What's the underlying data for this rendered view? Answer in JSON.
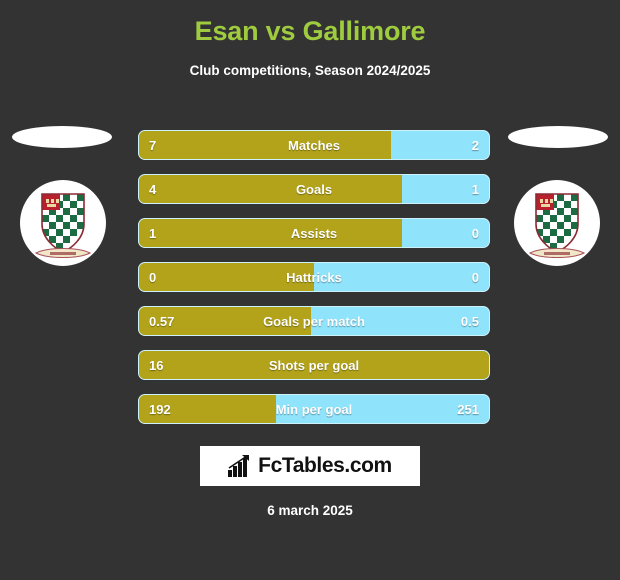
{
  "header": {
    "title": "Esan vs Gallimore",
    "subtitle": "Club competitions, Season 2024/2025"
  },
  "colors": {
    "background": "#333333",
    "title": "#9fcb3f",
    "home_bar": "#b3a31b",
    "away_bar": "#8fe3fb",
    "text": "#ffffff"
  },
  "crests": {
    "left_name": "club-crest-left",
    "right_name": "club-crest-right"
  },
  "chart_data": {
    "type": "bar",
    "title": "Esan vs Gallimore",
    "subtitle": "Club competitions, Season 2024/2025",
    "orientation": "horizontal-diverging",
    "series": [
      {
        "name": "Esan",
        "color": "#b3a31b"
      },
      {
        "name": "Gallimore",
        "color": "#8fe3fb"
      }
    ],
    "categories": [
      "Matches",
      "Goals",
      "Assists",
      "Hattricks",
      "Goals per match",
      "Shots per goal",
      "Min per goal"
    ],
    "rows": [
      {
        "label": "Matches",
        "home": "7",
        "away": "2",
        "home_pct": 72
      },
      {
        "label": "Goals",
        "home": "4",
        "away": "1",
        "home_pct": 75
      },
      {
        "label": "Assists",
        "home": "1",
        "away": "0",
        "home_pct": 75
      },
      {
        "label": "Hattricks",
        "home": "0",
        "away": "0",
        "home_pct": 50
      },
      {
        "label": "Goals per match",
        "home": "0.57",
        "away": "0.5",
        "home_pct": 49
      },
      {
        "label": "Shots per goal",
        "home": "16",
        "away": "",
        "home_pct": 100
      },
      {
        "label": "Min per goal",
        "home": "192",
        "away": "251",
        "home_pct": 39
      }
    ]
  },
  "footer": {
    "logo_text": "FcTables.com",
    "logo_icon": "bar-chart-icon",
    "date": "6 march 2025"
  }
}
